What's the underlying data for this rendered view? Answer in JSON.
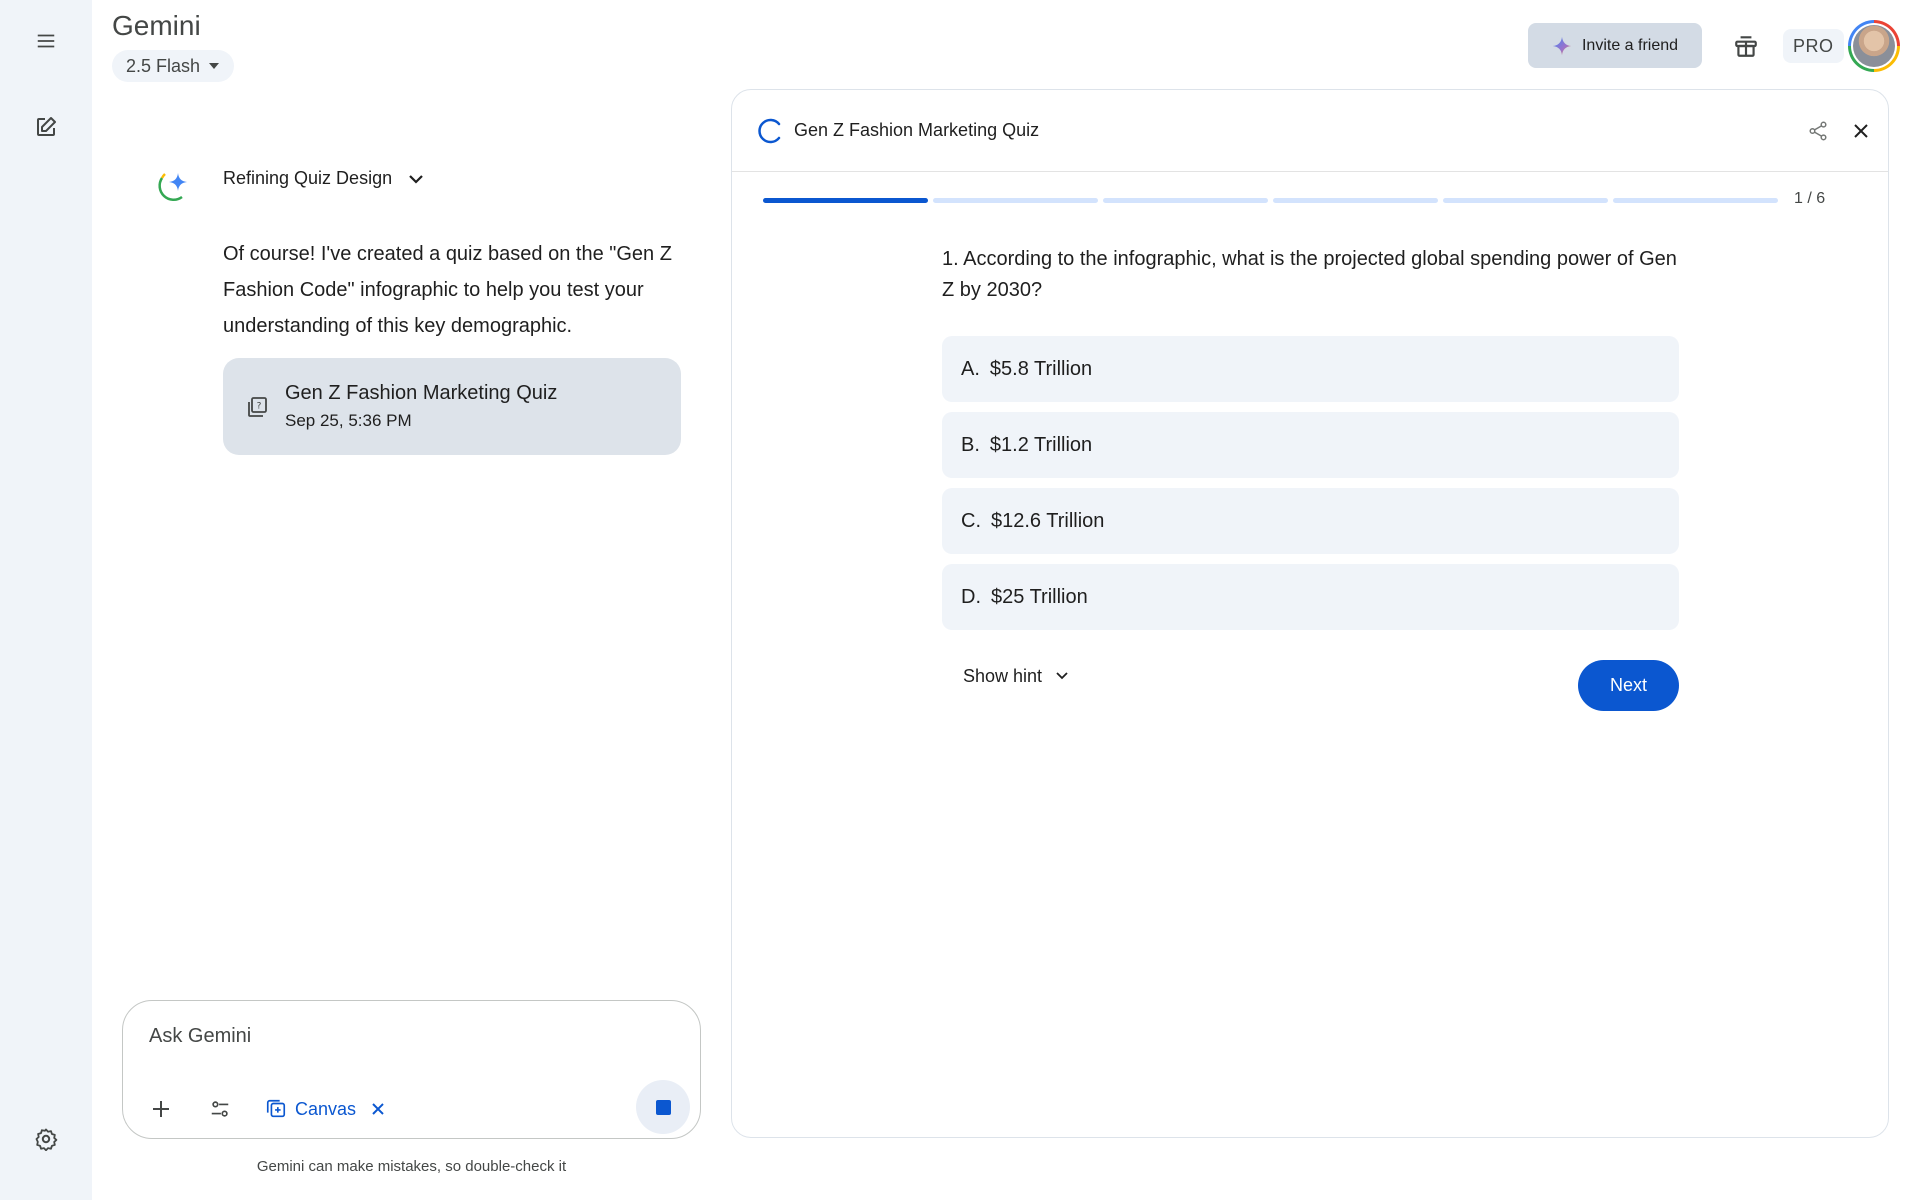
{
  "app": {
    "title": "Gemini",
    "model": "2.5 Flash"
  },
  "header": {
    "invite_label": "Invite a friend",
    "pro_label": "PRO"
  },
  "rail": {
    "icons": [
      "menu-icon",
      "new-chat-icon",
      "settings-icon"
    ]
  },
  "chat": {
    "thought_title": "Refining Quiz Design",
    "response": "Of course! I've created a quiz based on the \"Gen Z Fashion Code\" infographic to help you test your understanding of this key demographic.",
    "artifact": {
      "title": "Gen Z Fashion Marketing Quiz",
      "date": "Sep 25, 5:36 PM"
    }
  },
  "input": {
    "placeholder": "Ask Gemini",
    "canvas_label": "Canvas",
    "disclaimer": "Gemini can make mistakes, so double-check it"
  },
  "quiz": {
    "title": "Gen Z Fashion Marketing Quiz",
    "progress_text": "1 / 6",
    "progress": {
      "current": 1,
      "total": 6
    },
    "question": "1. According to the infographic, what is the projected global spending power of Gen Z by 2030?",
    "options": [
      {
        "letter": "A.",
        "text": "$5.8 Trillion"
      },
      {
        "letter": "B.",
        "text": "$1.2 Trillion"
      },
      {
        "letter": "C.",
        "text": "$12.6 Trillion"
      },
      {
        "letter": "D.",
        "text": "$25 Trillion"
      }
    ],
    "hint_label": "Show hint",
    "next_label": "Next"
  },
  "colors": {
    "accent": "#0b57d0",
    "rail_bg": "#f0f4f9",
    "option_bg": "#f0f4f9",
    "card_bg": "#dde3ea"
  }
}
